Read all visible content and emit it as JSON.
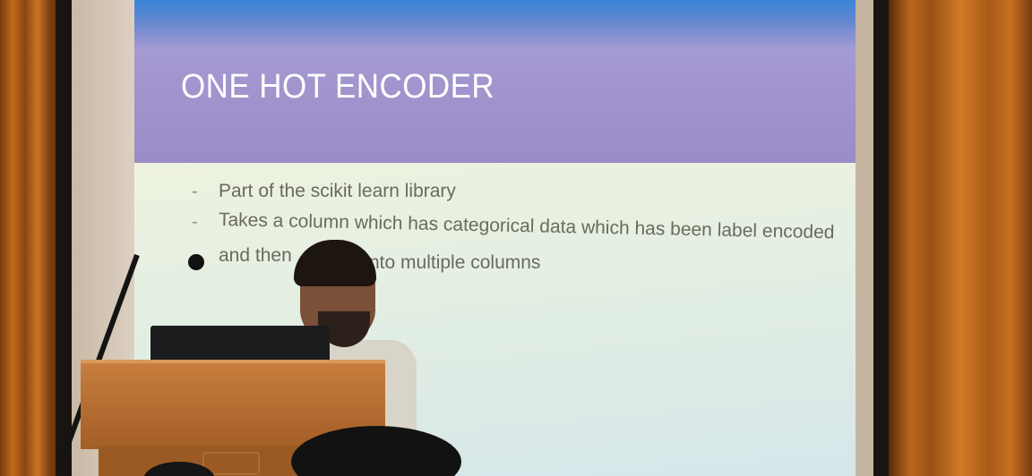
{
  "slide": {
    "title": "ONE HOT ENCODER",
    "bullets": [
      {
        "marker": "-",
        "text": "Part of the scikit learn library"
      },
      {
        "marker": "-",
        "text": "Takes a column which has categorical data which has been label encoded"
      }
    ],
    "continuation": {
      "left_text": "and then",
      "right_text": "nto multiple columns"
    }
  },
  "colors": {
    "header_top": "#3a86d8",
    "header_main": "#a193cc",
    "title_text": "#ffffff",
    "body_text": "#6a6a5e",
    "curtain": "#c06a1c",
    "podium": "#b8703a"
  },
  "icons": [
    "microphone-icon",
    "laptop-icon"
  ]
}
